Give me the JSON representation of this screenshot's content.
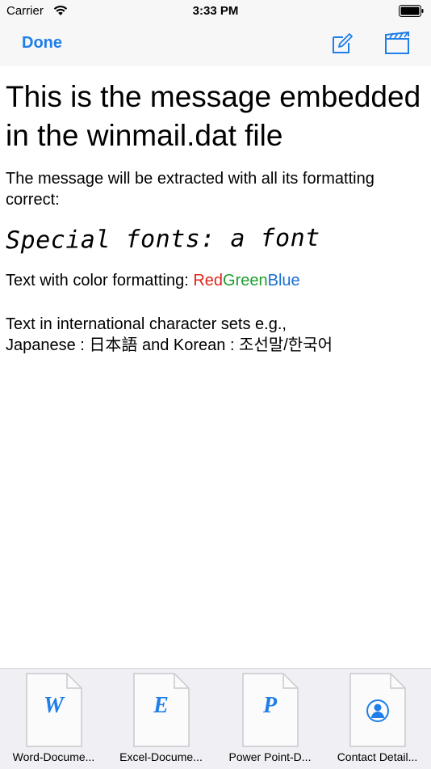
{
  "status_bar": {
    "carrier": "Carrier",
    "time": "3:33 PM"
  },
  "nav": {
    "done_label": "Done",
    "accent_color": "#1f7ee8",
    "icons": [
      "compose-icon",
      "clapperboard-icon"
    ]
  },
  "message": {
    "heading": "This is the message embedded in the winmail.dat file",
    "intro": "The message will be extracted with all its formatting correct:",
    "special_fonts": "Special fonts: a font",
    "color_prefix": "Text with color formatting: ",
    "color_red": "Red",
    "color_green": "Green",
    "color_blue": "Blue",
    "colors": {
      "red": "#e0231a",
      "green": "#1f9d2e",
      "blue": "#1a6fd0"
    },
    "intl_line1": "Text in international character sets e.g.,",
    "intl_line2": "Japanese : 日本語 and Korean : 조선말/한국어"
  },
  "attachments": [
    {
      "label": "Word-Docume...",
      "icon_letter": "W",
      "icon": "word-document-icon"
    },
    {
      "label": "Excel-Docume...",
      "icon_letter": "E",
      "icon": "excel-document-icon"
    },
    {
      "label": "Power Point-D...",
      "icon_letter": "P",
      "icon": "powerpoint-document-icon"
    },
    {
      "label": "Contact Detail...",
      "icon_letter": "",
      "icon": "contact-document-icon"
    }
  ]
}
